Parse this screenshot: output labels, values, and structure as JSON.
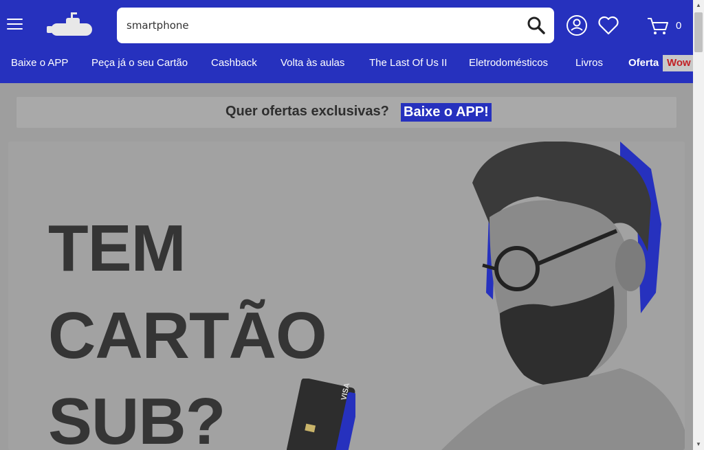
{
  "header": {
    "search": {
      "value": "smartphone",
      "placeholder": ""
    },
    "cart_count": "0"
  },
  "nav": {
    "items": [
      "Baixe o APP",
      "Peça já o seu Cartão",
      "Cashback",
      "Volta às aulas",
      "The Last Of Us II",
      "Eletrodomésticos",
      "Livros",
      "Oferta"
    ],
    "wow_label": "Wow"
  },
  "promo": {
    "text": "Quer ofertas exclusivas?",
    "link": "Baixe o APP!"
  },
  "banner": {
    "line1": "TEM",
    "line2": "CARTÃO",
    "line3": "SUB?",
    "card_brand": "VISA"
  },
  "colors": {
    "brand_blue": "#2631be",
    "wow_red": "#c21f24",
    "overlay_gray": "#9e9e9e"
  },
  "icons": [
    "menu-icon",
    "submarine-logo-icon",
    "search-icon",
    "user-icon",
    "heart-icon",
    "cart-icon"
  ]
}
